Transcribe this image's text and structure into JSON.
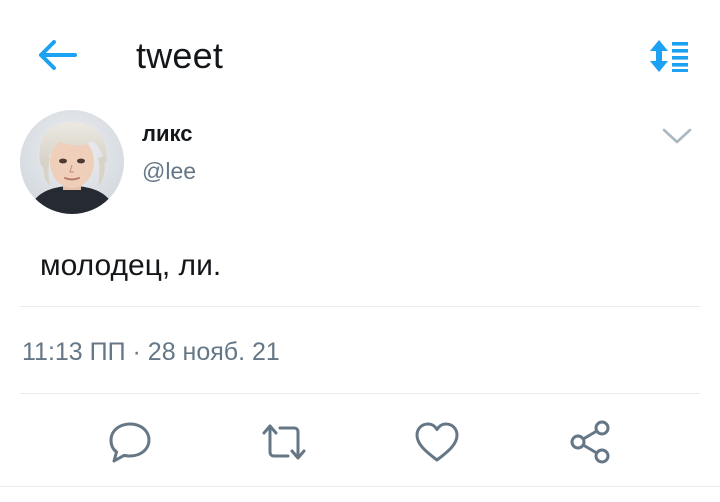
{
  "header": {
    "title": "tweet",
    "back_icon": "arrow-left-icon",
    "sort_icon": "sort-list-icon",
    "accent_color": "#1da1f2"
  },
  "tweet": {
    "author": {
      "display_name": "ликс",
      "handle": "@lee"
    },
    "text": "молодец, ли.",
    "timestamp": "11:13 ПП · 28 нояб. 21"
  },
  "actions": [
    {
      "icon": "reply-icon"
    },
    {
      "icon": "retweet-icon"
    },
    {
      "icon": "like-icon"
    },
    {
      "icon": "share-icon"
    }
  ],
  "colors": {
    "text_primary": "#14171a",
    "text_secondary": "#657786",
    "icon_gray": "#657786",
    "divider": "#e6ecf0"
  }
}
